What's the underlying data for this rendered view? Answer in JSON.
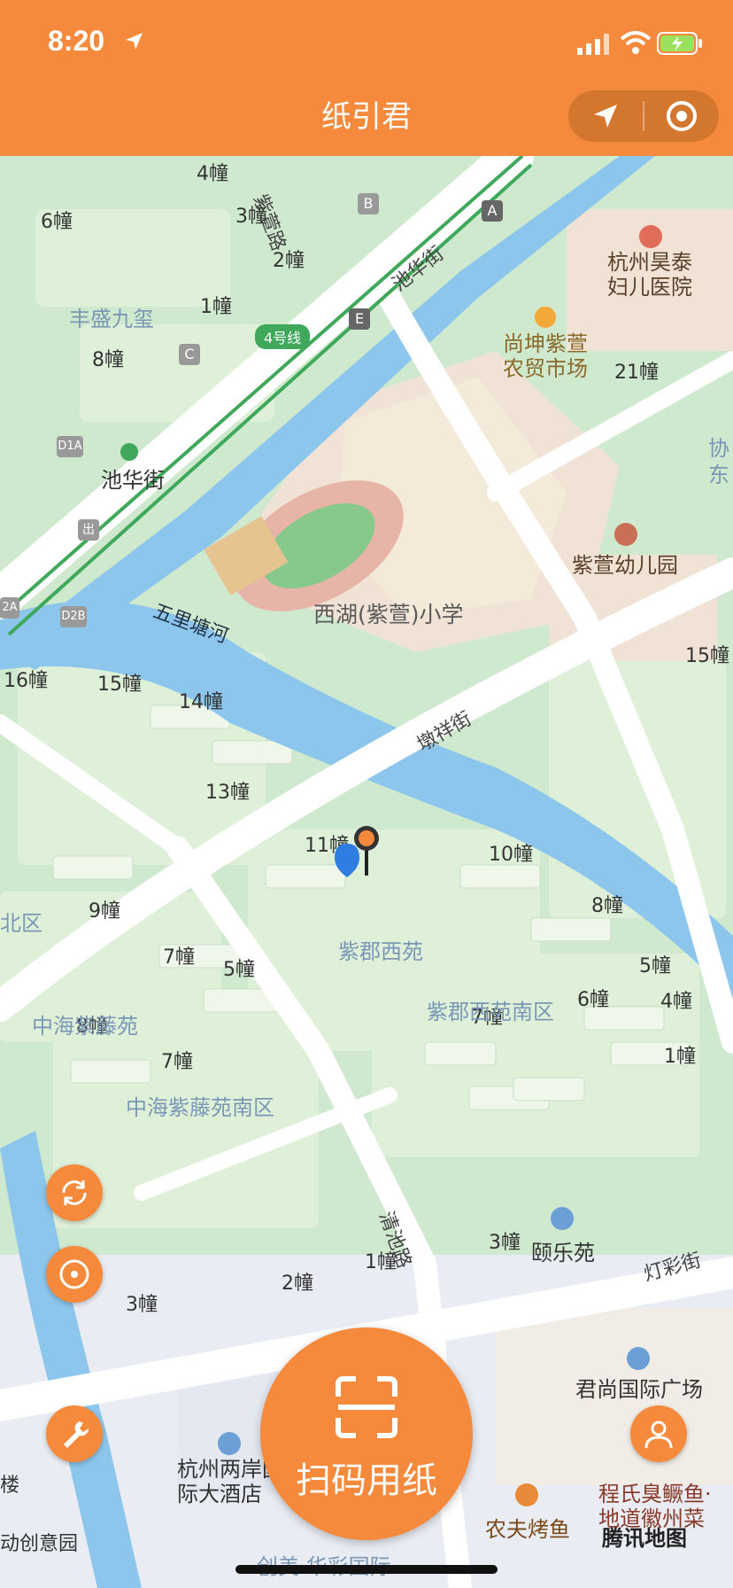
{
  "status_bar": {
    "time": "8:20"
  },
  "header": {
    "title": "纸引君"
  },
  "map": {
    "building_labels": [
      "4幢",
      "6幢",
      "3幢",
      "2幢",
      "1幢",
      "8幢",
      "21幢",
      "15幢",
      "16幢",
      "15幢",
      "14幢",
      "13幢",
      "11幢",
      "10幢",
      "9幢",
      "8幢",
      "7幢",
      "5幢",
      "6幢",
      "4幢",
      "7幢",
      "1幢",
      "8幢",
      "5幢",
      "3幢",
      "1幢",
      "2幢",
      "3幢",
      "7幢"
    ],
    "areas": {
      "fengsheng": "丰盛九玺",
      "west_lake_school": "西湖(紫萱)小学",
      "zijun_xiyuan": "紫郡西苑",
      "zijun_south": "紫郡西苑南区",
      "zhonghai": "中海紫藤苑",
      "zhonghai_south": "中海紫藤苑南区",
      "north_area": "北区"
    },
    "roads": {
      "zixuan": "紫萱路",
      "chihua": "池华街",
      "wuli": "五里塘河",
      "dunxiang": "墩祥街",
      "qingchi": "清池路",
      "dengcai": "灯彩街",
      "xie": "协",
      "dong": "东"
    },
    "metro": {
      "line": "4号线",
      "station": "池华街",
      "exits": [
        "B",
        "A",
        "E",
        "C",
        "D1A",
        "出",
        "2A",
        "D2B"
      ]
    },
    "pois": {
      "hospital": "杭州昊泰妇儿医院",
      "market": "尚坤紫萱农贸市场",
      "kindergarten": "紫萱幼儿园",
      "yilecun": "颐乐苑",
      "junshang": "君尚国际广场",
      "hotel": "杭州两岸国际大酒店",
      "bbq": "农夫烤鱼",
      "fish": "程氏臭鳜鱼·地道徽州菜",
      "chuangyi": "动创意园",
      "lou": "楼",
      "bottom": "创美·华彩国际"
    },
    "provider": "腾讯地图"
  },
  "actions": {
    "scan_label": "扫码用纸"
  },
  "icons": [
    "location-arrow-icon",
    "signal-icon",
    "wifi-icon",
    "battery-icon",
    "navigate-icon",
    "target-icon",
    "refresh-icon",
    "locate-icon",
    "wrench-icon",
    "user-icon",
    "scan-icon"
  ]
}
